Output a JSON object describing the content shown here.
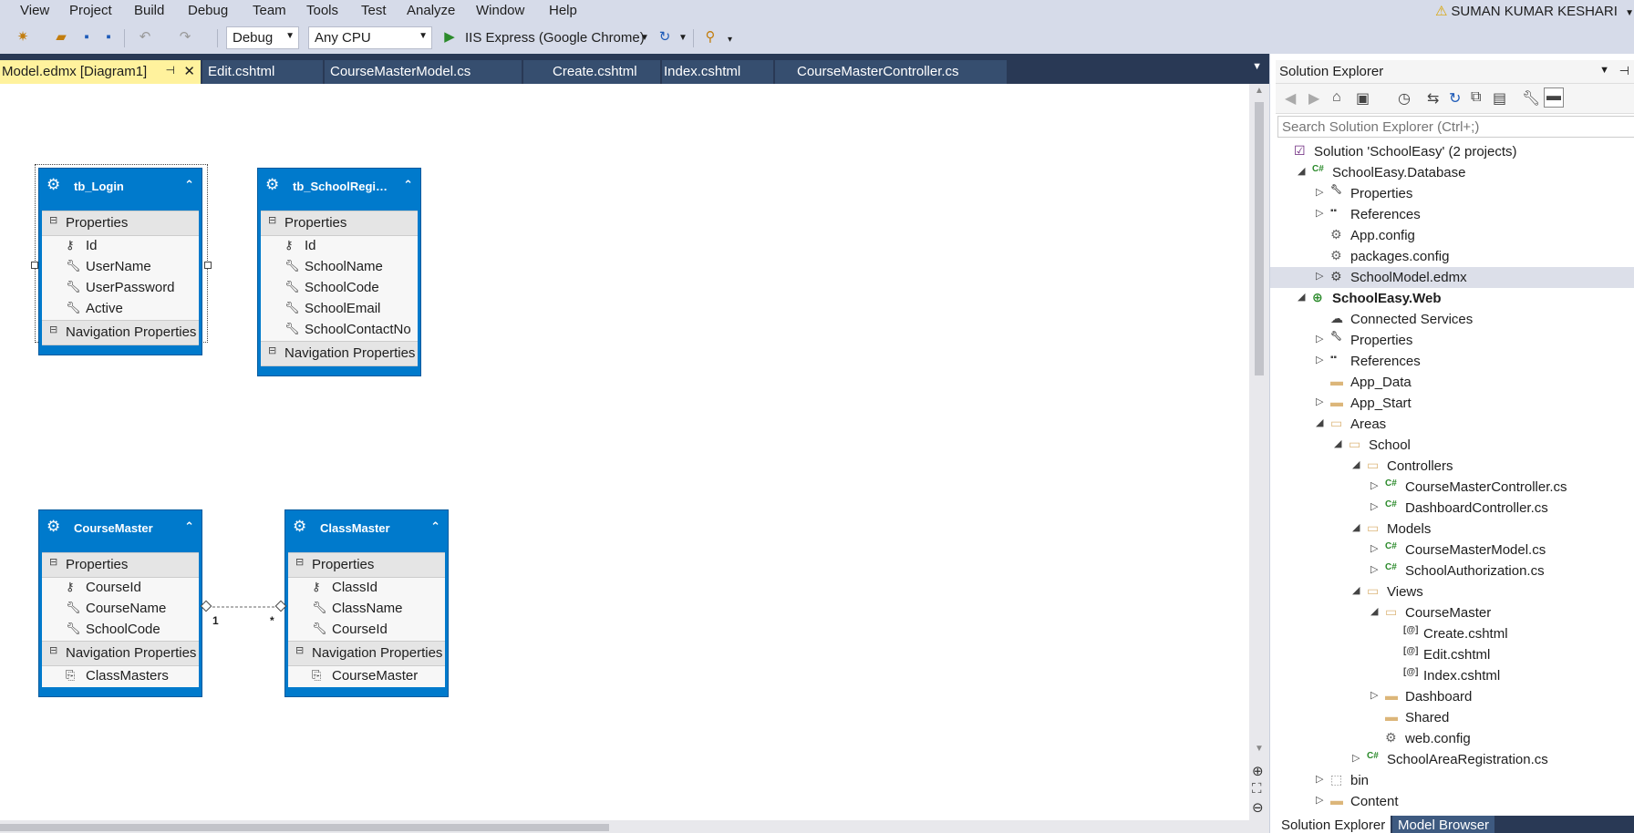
{
  "menu": {
    "items": [
      "View",
      "Project",
      "Build",
      "Debug",
      "Team",
      "Tools",
      "Test",
      "Analyze",
      "Window",
      "Help"
    ],
    "user": "SUMAN KUMAR KESHARI"
  },
  "toolbar": {
    "config": "Debug",
    "platform": "Any CPU",
    "run_target": "IIS Express (Google Chrome)"
  },
  "tabs": [
    {
      "label": "Model.edmx [Diagram1]",
      "active": true
    },
    {
      "label": "Edit.cshtml"
    },
    {
      "label": "CourseMasterModel.cs"
    },
    {
      "label": "Create.cshtml"
    },
    {
      "label": "Index.cshtml"
    },
    {
      "label": "CourseMasterController.cs"
    }
  ],
  "entities": {
    "login": {
      "title": "tb_Login",
      "properties_label": "Properties",
      "nav_label": "Navigation Properties",
      "properties": [
        "Id",
        "UserName",
        "UserPassword",
        "Active"
      ]
    },
    "school": {
      "title": "tb_SchoolRegi…",
      "properties_label": "Properties",
      "nav_label": "Navigation Properties",
      "properties": [
        "Id",
        "SchoolName",
        "SchoolCode",
        "SchoolEmail",
        "SchoolContactNo"
      ]
    },
    "course": {
      "title": "CourseMaster",
      "properties_label": "Properties",
      "nav_label": "Navigation Properties",
      "properties": [
        "CourseId",
        "CourseName",
        "SchoolCode"
      ],
      "nav": [
        "ClassMasters"
      ]
    },
    "class": {
      "title": "ClassMaster",
      "properties_label": "Properties",
      "nav_label": "Navigation Properties",
      "properties": [
        "ClassId",
        "ClassName",
        "CourseId"
      ],
      "nav": [
        "CourseMaster"
      ]
    }
  },
  "association": {
    "left": "1",
    "right": "*"
  },
  "solution_explorer": {
    "title": "Solution Explorer",
    "search_placeholder": "Search Solution Explorer (Ctrl+;)",
    "tree": [
      "Solution 'SchoolEasy' (2 projects)",
      "SchoolEasy.Database",
      "Properties",
      "References",
      "App.config",
      "packages.config",
      "SchoolModel.edmx",
      "SchoolEasy.Web",
      "Connected Services",
      "Properties",
      "References",
      "App_Data",
      "App_Start",
      "Areas",
      "School",
      "Controllers",
      "CourseMasterController.cs",
      "DashboardController.cs",
      "Models",
      "CourseMasterModel.cs",
      "SchoolAuthorization.cs",
      "Views",
      "CourseMaster",
      "Create.cshtml",
      "Edit.cshtml",
      "Index.cshtml",
      "Dashboard",
      "Shared",
      "web.config",
      "SchoolAreaRegistration.cs",
      "bin",
      "Content"
    ],
    "bottom_tabs": [
      "Solution Explorer",
      "Model Browser"
    ]
  }
}
